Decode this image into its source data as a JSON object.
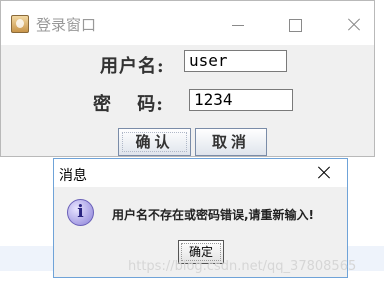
{
  "login_window": {
    "title": "登录窗口",
    "username_label": "用户名:",
    "username_value": "user",
    "password_label": "密 码:",
    "password_value": "1234",
    "ok_button": "确认",
    "cancel_button": "取消"
  },
  "message_dialog": {
    "title": "消息",
    "icon": "information-icon",
    "icon_glyph": "i",
    "message": "用户名不存在或密码错误,请重新输入!",
    "ok_button": "确定"
  },
  "watermark": "https://blog.csdn.net/qq_37808565"
}
